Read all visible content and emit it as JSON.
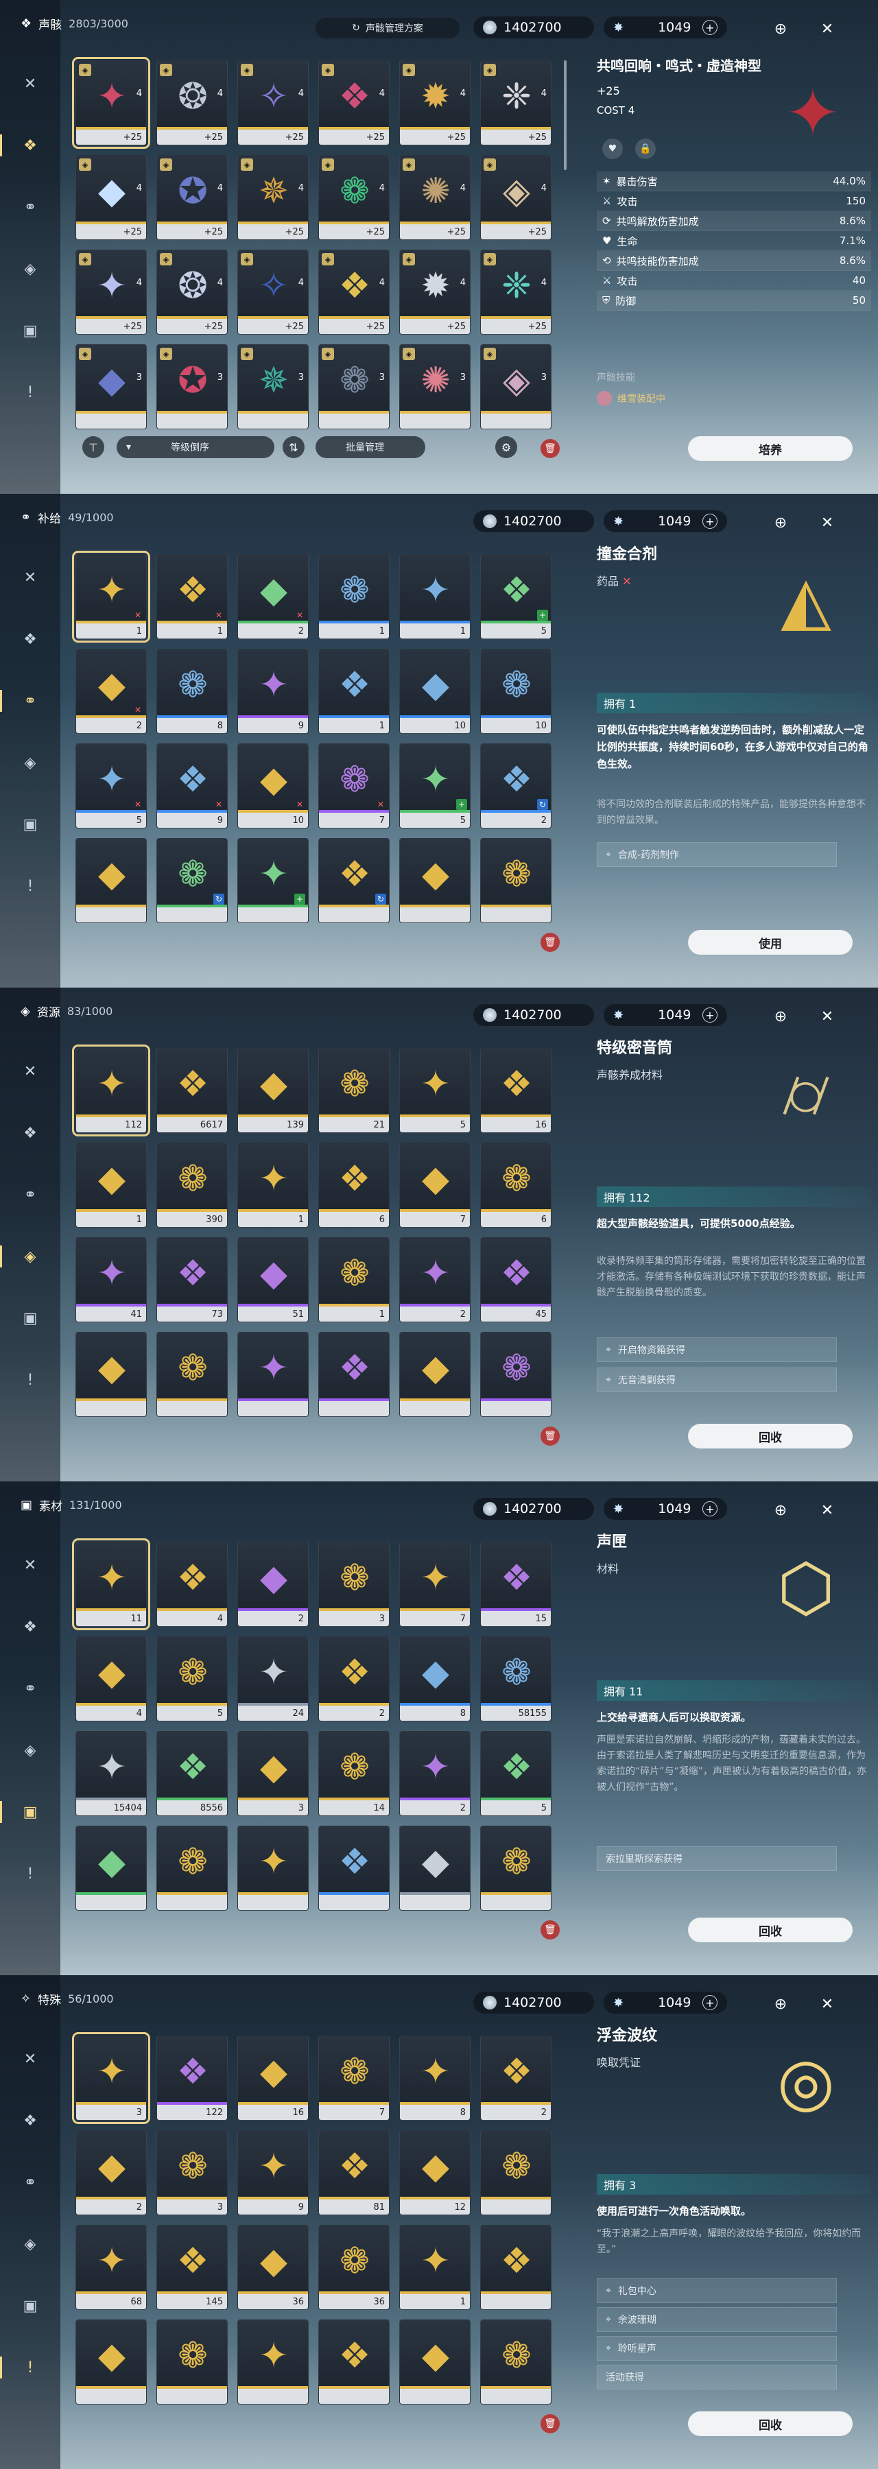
{
  "screens": {
    "echo": {
      "category": "声骸",
      "count": "2803/3000",
      "preset": "声骸管理方案",
      "shell_credits": "1402700",
      "astrite": "1049",
      "sort_label": "等级倒序",
      "bulk_label": "批量管理",
      "title": "共鸣回响・鸣式・虚造神型",
      "level": "+25",
      "cost": "COST  4",
      "stats": [
        {
          "label": "暴击伤害",
          "value": "44.0%"
        },
        {
          "label": "攻击",
          "value": "150"
        },
        {
          "label": "共鸣解放伤害加成",
          "value": "8.6%"
        },
        {
          "label": "生命",
          "value": "7.1%"
        },
        {
          "label": "共鸣技能伤害加成",
          "value": "8.6%"
        },
        {
          "label": "攻击",
          "value": "40"
        },
        {
          "label": "防御",
          "value": "50"
        }
      ],
      "skill_label": "声骸技能",
      "equipped": "维雪装配中",
      "action": "培养",
      "items": [
        {
          "lv": "+25",
          "c": "4"
        },
        {
          "lv": "+25",
          "c": "4"
        },
        {
          "lv": "+25",
          "c": "4"
        },
        {
          "lv": "+25",
          "c": "4"
        },
        {
          "lv": "+25",
          "c": "4"
        },
        {
          "lv": "+25",
          "c": "4"
        },
        {
          "lv": "+25",
          "c": "4"
        },
        {
          "lv": "+25",
          "c": "4"
        },
        {
          "lv": "+25",
          "c": "4"
        },
        {
          "lv": "+25",
          "c": "4"
        },
        {
          "lv": "+25",
          "c": "4"
        },
        {
          "lv": "+25",
          "c": "4"
        },
        {
          "lv": "+25",
          "c": "4"
        },
        {
          "lv": "+25",
          "c": "4"
        },
        {
          "lv": "+25",
          "c": "4"
        },
        {
          "lv": "+25",
          "c": "4"
        },
        {
          "lv": "+25",
          "c": "4"
        },
        {
          "lv": "+25",
          "c": "4"
        },
        {
          "lv": "",
          "c": "3"
        },
        {
          "lv": "",
          "c": "3"
        },
        {
          "lv": "",
          "c": "3"
        },
        {
          "lv": "",
          "c": "3"
        },
        {
          "lv": "",
          "c": "3"
        },
        {
          "lv": "",
          "c": "3"
        }
      ]
    },
    "supply": {
      "category": "补给",
      "count": "49/1000",
      "shell_credits": "1402700",
      "astrite": "1049",
      "title": "撞金合剂",
      "type": "药品",
      "owned": "拥有 1",
      "desc": "可使队伍中指定共鸣者触发逆势回击时，额外削减敌人一定比例的共振度，持续时间60秒，在多人游戏中仅对自己的角色生效。",
      "lore": "将不同功效的合剂联装后制成的特殊产品，能够提供各种意想不到的增益效果。",
      "source": "合成-药剂制作",
      "action": "使用",
      "counts": [
        "1",
        "1",
        "2",
        "1",
        "1",
        "5",
        "2",
        "8",
        "9",
        "1",
        "10",
        "10",
        "5",
        "9",
        "10",
        "7",
        "5",
        "2",
        "",
        "",
        "",
        "",
        "",
        ""
      ]
    },
    "resource": {
      "category": "资源",
      "count": "83/1000",
      "shell_credits": "1402700",
      "astrite": "1049",
      "title": "特级密音筒",
      "type": "声骸养成材料",
      "owned": "拥有 112",
      "desc": "超大型声骸经验道具，可提供5000点经验。",
      "lore": "收录特殊频率集的筒形存储器，需要将加密转轮旋至正确的位置才能激活。存储有各种极端测试环境下获取的珍贵数据，能让声骸产生脱胎换骨般的质变。",
      "sources": [
        "开启物资箱获得",
        "无音清剿获得"
      ],
      "action": "回收",
      "counts": [
        "112",
        "6617",
        "139",
        "21",
        "5",
        "16",
        "1",
        "390",
        "1",
        "6",
        "7",
        "6",
        "41",
        "73",
        "51",
        "1",
        "2",
        "45",
        "",
        "",
        "",
        "",
        "",
        ""
      ]
    },
    "material": {
      "category": "素材",
      "count": "131/1000",
      "shell_credits": "1402700",
      "astrite": "1049",
      "title": "声匣",
      "type": "材料",
      "owned": "拥有 11",
      "desc": "上交给寻遗商人后可以换取资源。",
      "lore": "声匣是索诺拉自然崩解、坍缩形成的产物，蕴藏着未实的过去。由于索诺拉是人类了解悲鸣历史与文明变迁的重要信息源，作为索诺拉的“碎片”与“凝缩”，声匣被认为有着极高的稿古价值，亦被人们视作“古物”。",
      "source": "索拉里斯探索获得",
      "action": "回收",
      "counts": [
        "11",
        "4",
        "2",
        "3",
        "7",
        "15",
        "4",
        "5",
        "24",
        "2",
        "8",
        "58155",
        "15404",
        "8556",
        "3",
        "14",
        "2",
        "5",
        "",
        "",
        "",
        "",
        "",
        ""
      ]
    },
    "special": {
      "category": "特殊",
      "count": "56/1000",
      "shell_credits": "1402700",
      "astrite": "1049",
      "title": "浮金波纹",
      "type": "唤取凭证",
      "owned": "拥有 3",
      "desc": "使用后可进行一次角色活动唤取。",
      "lore": "“我于浪潮之上高声呼唤，耀眼的波纹给予我回应，你将如约而至。”",
      "sources": [
        "礼包中心",
        "余波珊瑚",
        "聆听星声",
        "活动获得"
      ],
      "action": "回收",
      "counts": [
        "3",
        "122",
        "16",
        "7",
        "8",
        "2",
        "2",
        "3",
        "9",
        "81",
        "12",
        "",
        "68",
        "145",
        "36",
        "36",
        "1",
        "",
        "",
        "",
        "",
        "",
        "",
        ""
      ]
    }
  },
  "icons": {
    "rail": [
      "swords-icon",
      "mask-icon",
      "capsule-icon",
      "cube-icon",
      "box-icon",
      "alert-icon"
    ],
    "accent": "#e8cf8a"
  }
}
